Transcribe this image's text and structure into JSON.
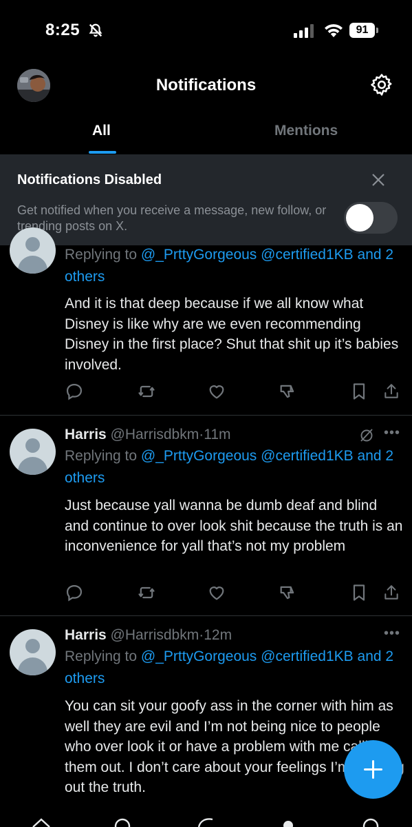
{
  "status_bar": {
    "time": "8:25",
    "battery": "91"
  },
  "header": {
    "title": "Notifications"
  },
  "tabs": [
    {
      "label": "All",
      "active": true
    },
    {
      "label": "Mentions",
      "active": false
    }
  ],
  "banner": {
    "title": "Notifications Disabled",
    "description": "Get notified when you receive a message, new follow, or trending posts on X.",
    "toggle_on": false
  },
  "posts": [
    {
      "author": "",
      "handle": "",
      "replying_prefix": "Replying to",
      "mention1": "@_PrttyGorgeous",
      "mention2": "@certified1KB",
      "replying_and": "and",
      "others": "2 others",
      "text": "And it is that deep because if we all know what Disney is like why are we even recommending Disney in the first place? Shut that shit up it’s babies involved."
    },
    {
      "author": "Harris",
      "handle": "@Harrisdbkm",
      "sep": "·",
      "time": "11m",
      "replying_prefix": "Replying to",
      "mention1": "@_PrttyGorgeous",
      "mention2": "@certified1KB",
      "replying_and": "and",
      "others": "2 others",
      "text": "Just because yall wanna be dumb deaf and blind and continue to over look shit because the truth is an inconvenience for yall that’s not my problem"
    },
    {
      "author": "Harris",
      "handle": "@Harrisdbkm",
      "sep": "·",
      "time": "12m",
      "replying_prefix": "Replying to",
      "mention1": "@_PrttyGorgeous",
      "mention2": "@certified1KB",
      "replying_and": "and",
      "others": "2 others",
      "text": "You can sit your goofy ass in the corner with him as well they are evil and I’m not being nice to people who over look it or have a problem with me calling them out. I don’t care about your feelings I’m pointing out the truth."
    }
  ],
  "icons": {
    "reply": "reply-icon",
    "repost": "repost-icon",
    "like": "like-icon",
    "downvote": "downvote-icon",
    "bookmark": "bookmark-icon",
    "share": "share-icon",
    "mute": "mute-thread-icon",
    "more": "more-icon",
    "compose": "compose-icon",
    "settings": "gear-icon"
  },
  "colors": {
    "accent": "#1d9bf0",
    "banner_bg": "#23272c",
    "muted_text": "#71767b"
  }
}
